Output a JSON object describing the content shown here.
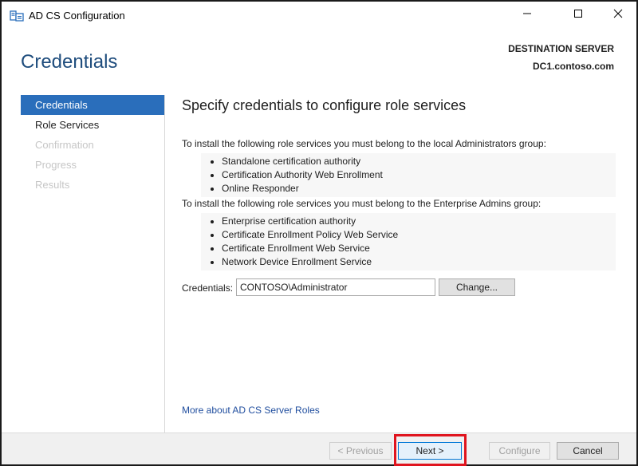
{
  "window": {
    "title": "AD CS Configuration",
    "app_icon": "certificate-server-icon",
    "controls": {
      "minimize": "minimize-icon",
      "maximize": "maximize-icon",
      "close": "close-icon"
    }
  },
  "header": {
    "page_title": "Credentials",
    "destination_label": "DESTINATION SERVER",
    "destination_server": "DC1.contoso.com"
  },
  "nav": {
    "items": [
      {
        "label": "Credentials",
        "state": "active"
      },
      {
        "label": "Role Services",
        "state": "enabled"
      },
      {
        "label": "Confirmation",
        "state": "disabled"
      },
      {
        "label": "Progress",
        "state": "disabled"
      },
      {
        "label": "Results",
        "state": "disabled"
      }
    ]
  },
  "content": {
    "title": "Specify credentials to configure role services",
    "local_admin_group": {
      "heading": "To install the following role services you must belong to the local Administrators group:",
      "items": [
        "Standalone certification authority",
        "Certification Authority Web Enrollment",
        "Online Responder"
      ]
    },
    "enterprise_admin_group": {
      "heading": "To install the following role services you must belong to the Enterprise Admins group:",
      "items": [
        "Enterprise certification authority",
        "Certificate Enrollment Policy Web Service",
        "Certificate Enrollment Web Service",
        "Network Device Enrollment Service"
      ]
    },
    "credentials": {
      "label": "Credentials:",
      "value": "CONTOSO\\Administrator",
      "change_label": "Change..."
    },
    "more_link": "More about AD CS Server Roles"
  },
  "footer": {
    "previous_label": "< Previous",
    "next_label": "Next >",
    "configure_label": "Configure",
    "cancel_label": "Cancel"
  },
  "colors": {
    "accent": "#2a6ebb",
    "heading": "#1f4d7d",
    "highlight": "#e0141e"
  }
}
